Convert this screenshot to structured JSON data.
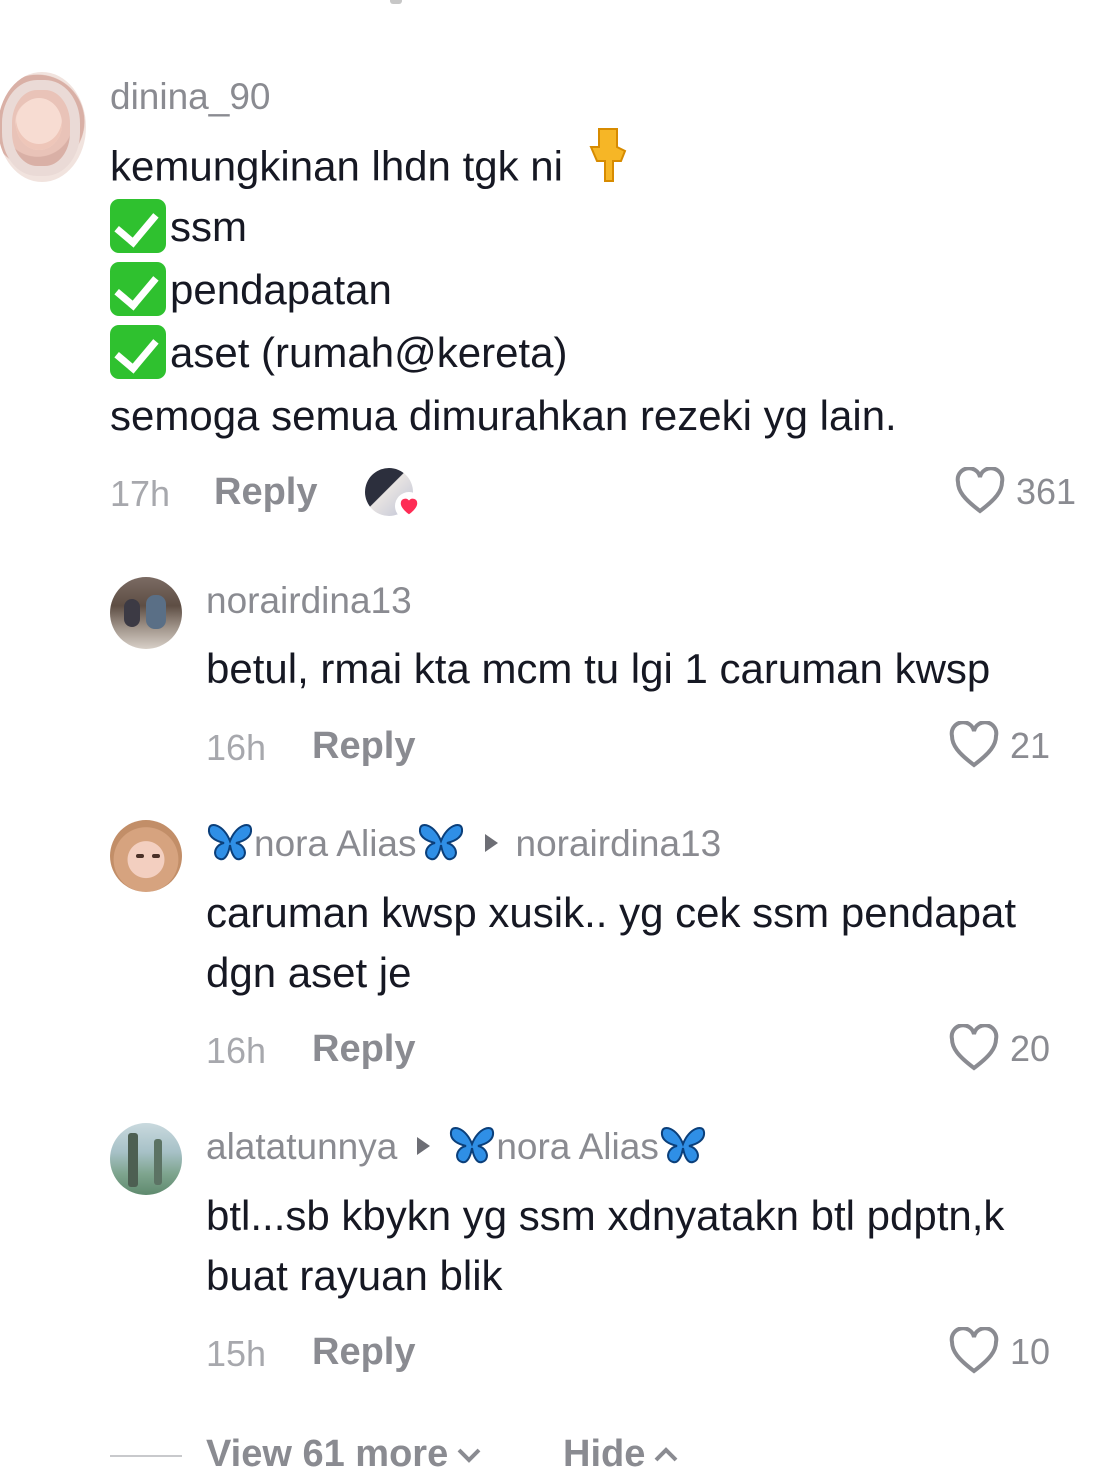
{
  "comments": [
    {
      "username": "dinina_90",
      "lines": [
        "kemungkinan lhdn tgk ni",
        "ssm",
        "pendapatan",
        "aset (rumah@kereta)",
        "semoga semua dimurahkan rezeki yg lain."
      ],
      "time": "17h",
      "reply_label": "Reply",
      "likes": "361",
      "liked_by_creator": true
    },
    {
      "username": "norairdina13",
      "lines": [
        "betul, rmai kta mcm tu lgi 1 caruman kwsp"
      ],
      "time": "16h",
      "reply_label": "Reply",
      "likes": "21"
    },
    {
      "username": "nora Alias",
      "reply_to": "norairdina13",
      "lines": [
        "caruman kwsp xusik.. yg cek ssm pendapat",
        "dgn aset je"
      ],
      "time": "16h",
      "reply_label": "Reply",
      "likes": "20"
    },
    {
      "username": "alatatunnya",
      "reply_to": "nora Alias",
      "lines": [
        "btl...sb kbykn yg ssm xdnyatakn btl pdptn,k",
        "buat rayuan blik"
      ],
      "time": "15h",
      "reply_label": "Reply",
      "likes": "10"
    }
  ],
  "footer": {
    "view_more": "View 61 more",
    "hide": "Hide"
  },
  "colors": {
    "check_green": "#2fc12f",
    "butterfly_blue": "#2f8fe6",
    "like_heart": "#fe2c55"
  },
  "icons": [
    "check-icon",
    "pointing-down-icon",
    "heart-icon",
    "butterfly-icon",
    "chevron-down-icon",
    "chevron-up-icon"
  ]
}
